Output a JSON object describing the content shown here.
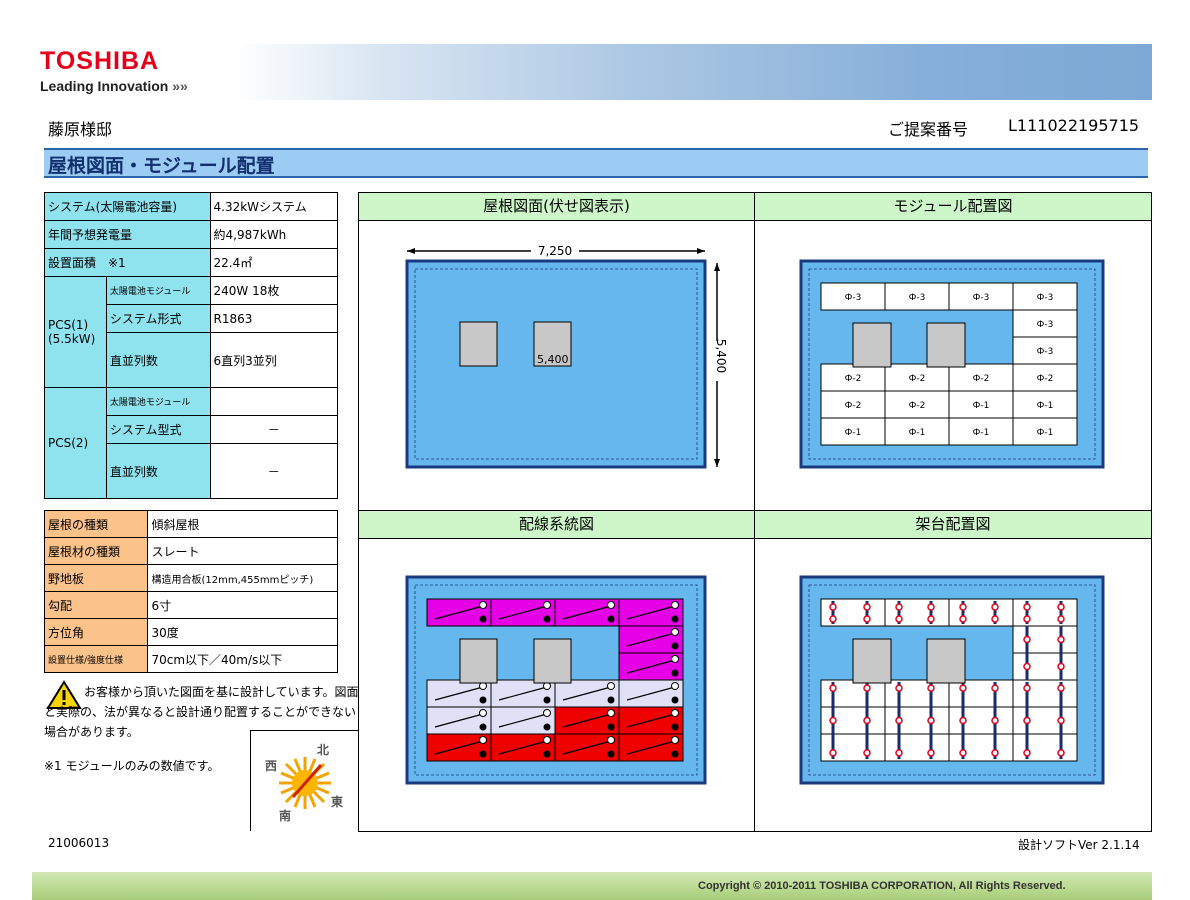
{
  "header": {
    "brand": "TOSHIBA",
    "tagline": "Leading Innovation",
    "tagline_arrows": "»»",
    "owner": "藤原様邸",
    "proposal_label": "ご提案番号",
    "proposal_number": "L111022195715"
  },
  "title": "屋根図面・モジュール配置",
  "system_table": {
    "system_label": "システム(太陽電池容量)",
    "system_value": "4.32kWシステム",
    "annual_label": "年間予想発電量",
    "annual_value": "約4,987kWh",
    "area_label": "設置面積　※1",
    "area_value": "22.4㎡",
    "pcs1_label": "PCS(1)\n(5.5kW)",
    "pcs1_rows": [
      {
        "label": "太陽電池モジュール",
        "value": "240W 18枚"
      },
      {
        "label": "システム形式",
        "value": "R1863"
      },
      {
        "label": "直並列数",
        "value": "6直列3並列"
      }
    ],
    "pcs2_label": "PCS(2)",
    "pcs2_rows": [
      {
        "label": "太陽電池モジュール",
        "value": ""
      },
      {
        "label": "システム型式",
        "value": "－"
      },
      {
        "label": "直並列数",
        "value": "－"
      }
    ]
  },
  "roof_table": [
    {
      "label": "屋根の種類",
      "value": "傾斜屋根"
    },
    {
      "label": "屋根材の種類",
      "value": "スレート"
    },
    {
      "label": "野地板",
      "value": "構造用合板(12mm,455mmピッチ)"
    },
    {
      "label": "勾配",
      "value": "6寸"
    },
    {
      "label": "方位角",
      "value": "30度"
    },
    {
      "label": "設置仕様/強度仕様",
      "value": "70cm以下／40m/s以下"
    }
  ],
  "notes": {
    "warning": "お客様から頂いた図面を基に設計しています。図面と実際の、法が異なると設計通り配置することができない場合があります。",
    "footnote": "※1  モジュールのみの数値です。"
  },
  "compass": {
    "north": "北",
    "south": "南",
    "east": "東",
    "west": "西"
  },
  "panels": {
    "roof": {
      "title": "屋根図面(伏せ図表示)",
      "width_dim": "7,250",
      "height_dim": "5,400",
      "inner_dim": "5,400"
    },
    "module": {
      "title": "モジュール配置図",
      "cells": [
        [
          "Ф-3",
          "Ф-3",
          "Ф-3",
          "Ф-3"
        ],
        [
          "",
          "",
          "",
          "Ф-3"
        ],
        [
          "",
          "",
          "",
          "Ф-3"
        ],
        [
          "Ф-2",
          "Ф-2",
          "Ф-2",
          "Ф-2"
        ],
        [
          "Ф-2",
          "Ф-2",
          "Ф-1",
          "Ф-1"
        ],
        [
          "Ф-1",
          "Ф-1",
          "Ф-1",
          "Ф-1"
        ]
      ]
    },
    "wiring": {
      "title": "配線系統図"
    },
    "rack": {
      "title": "架台配置図"
    }
  },
  "footer": {
    "doc_number": "21006013",
    "software_version": "設計ソフトVer 2.1.14",
    "copyright": "Copyright ©  2010-2011 TOSHIBA CORPORATION, All Rights Reserved."
  },
  "colors": {
    "roof_blue": "#66b7ee",
    "frame_navy": "#1a3a7e",
    "panel_header_green": "#cdf7c8",
    "label_cyan": "#8ee3ef",
    "label_orange": "#fbc28a",
    "title_blue": "#9ccbf3",
    "magenta": "#e600e6",
    "red": "#ee0000",
    "lavender": "#e0e0f6"
  }
}
